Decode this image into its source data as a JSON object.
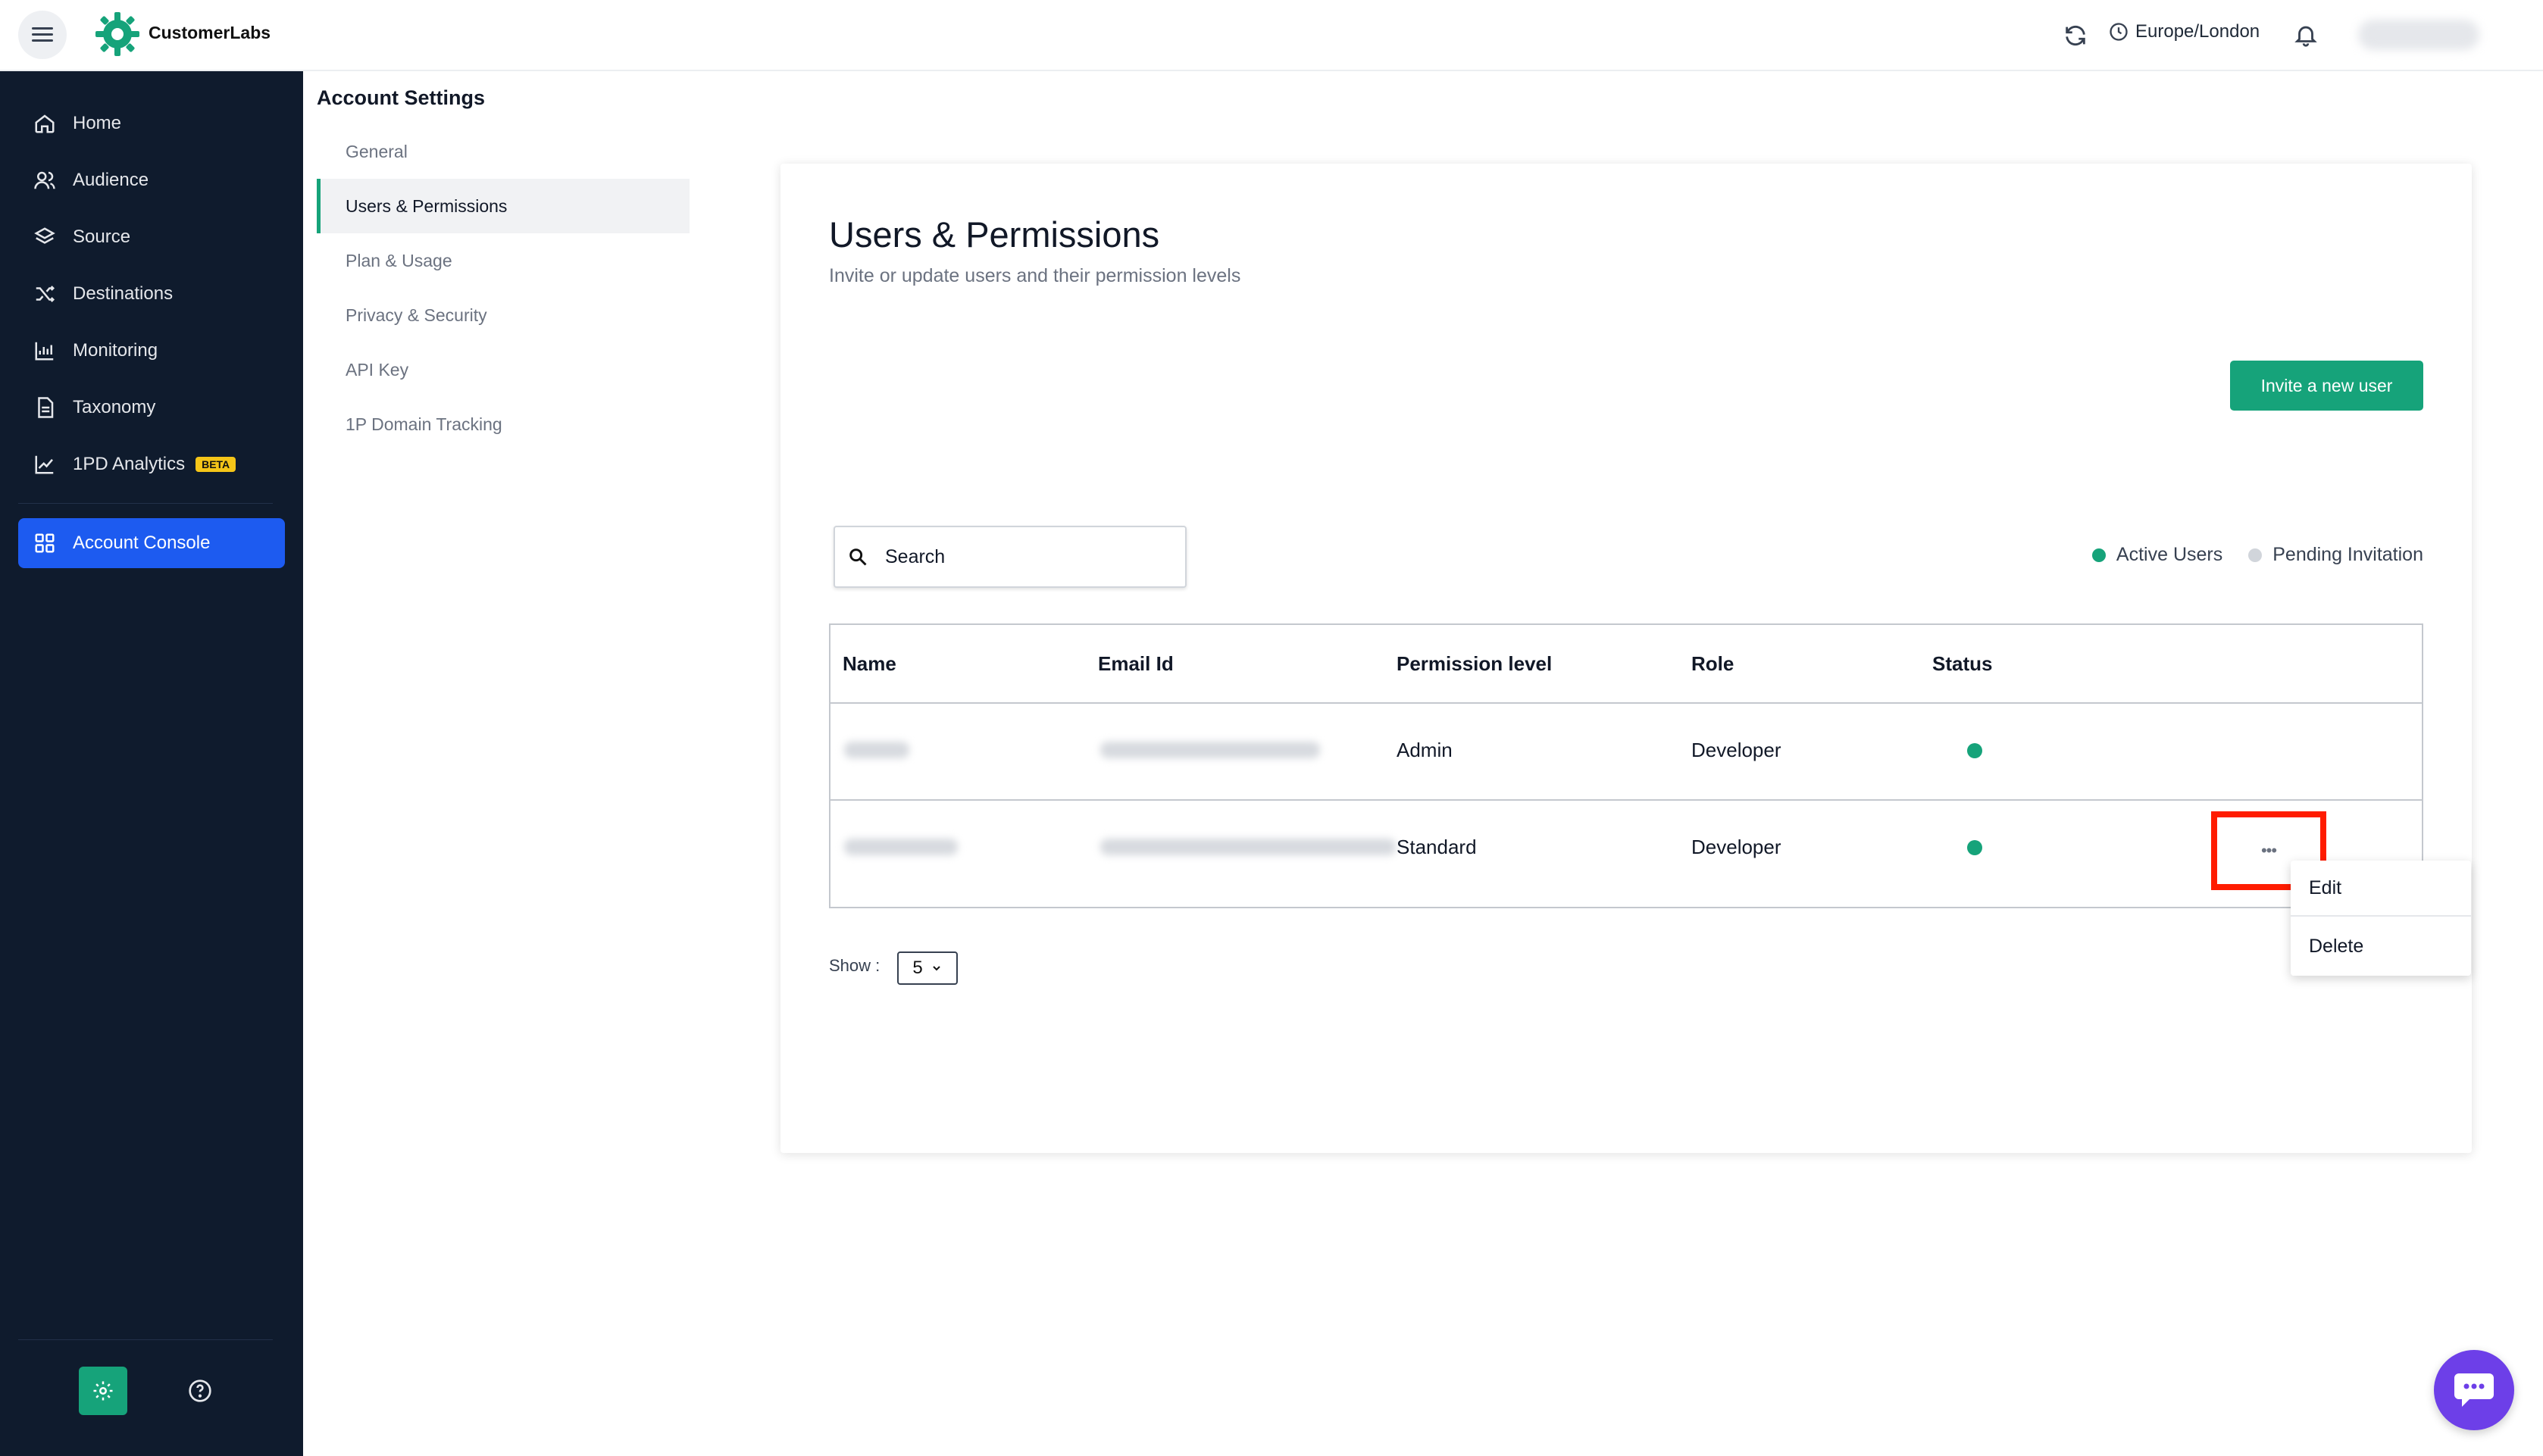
{
  "app": {
    "brand": "CustomerLabs",
    "timezone": "Europe/London"
  },
  "sidebar": {
    "items": [
      {
        "label": "Home",
        "icon": "home-icon"
      },
      {
        "label": "Audience",
        "icon": "users-icon"
      },
      {
        "label": "Source",
        "icon": "layers-icon"
      },
      {
        "label": "Destinations",
        "icon": "shuffle-icon"
      },
      {
        "label": "Monitoring",
        "icon": "chart-icon"
      },
      {
        "label": "Taxonomy",
        "icon": "document-icon"
      },
      {
        "label": "1PD Analytics",
        "icon": "trend-icon",
        "badge": "BETA"
      },
      {
        "label": "Account Console",
        "icon": "grid-icon",
        "active": true
      }
    ]
  },
  "settings_nav": {
    "title": "Account Settings",
    "items": [
      "General",
      "Users & Permissions",
      "Plan & Usage",
      "Privacy & Security",
      "API Key",
      "1P Domain Tracking"
    ],
    "active_index": 1
  },
  "main": {
    "title": "Users & Permissions",
    "subtitle": "Invite or update users and their permission levels",
    "invite_button": "Invite a new user",
    "search_placeholder": "Search",
    "legend": {
      "active": "Active Users",
      "pending": "Pending Invitation",
      "active_color": "#16a37a",
      "pending_color": "#d1d5db"
    },
    "table": {
      "columns": [
        "Name",
        "Email Id",
        "Permission level",
        "Role",
        "Status"
      ],
      "rows": [
        {
          "permission": "Admin",
          "role": "Developer"
        },
        {
          "permission": "Standard",
          "role": "Developer"
        }
      ]
    },
    "show_label": "Show :",
    "show_value": "5"
  },
  "row_menu": {
    "items": [
      "Edit",
      "Delete"
    ]
  },
  "colors": {
    "accent": "#16a37a",
    "sidebar_bg": "#0f1b2d",
    "active_nav": "#1d5bf0",
    "chat": "#6d3fe8",
    "highlight": "#ff1c00"
  }
}
